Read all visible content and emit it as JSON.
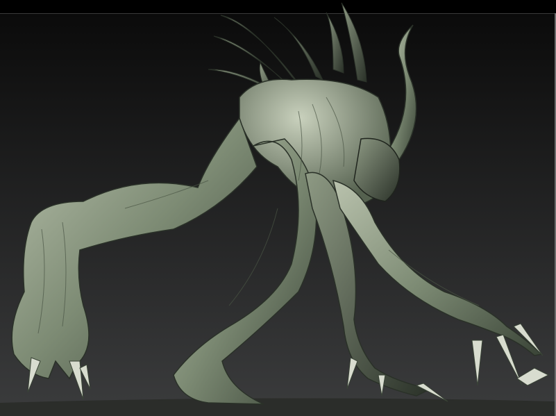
{
  "scene": {
    "subject": "creature-sculpt",
    "colors": {
      "backdrop_top": "#0b0b0b",
      "backdrop_bottom": "#3b3c3d",
      "skin_light": "#b9c2ad",
      "skin_mid": "#7d8b74",
      "skin_dark": "#2a3128",
      "ground": "#2b2d2a",
      "frame_top": "#000000",
      "frame_right": "#6c6c6c"
    }
  }
}
